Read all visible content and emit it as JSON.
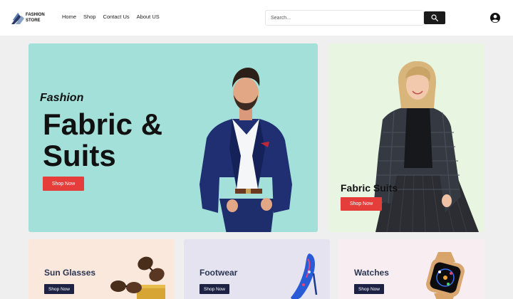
{
  "header": {
    "logo": {
      "line1": "FASHION",
      "line2": "STORE"
    },
    "nav": [
      {
        "label": "Home"
      },
      {
        "label": "Shop"
      },
      {
        "label": "Contact Us"
      },
      {
        "label": "About US"
      }
    ],
    "search": {
      "placeholder": "Search...",
      "icon": "search-icon"
    },
    "user_icon": "user-circle-icon"
  },
  "hero": {
    "subtitle": "Fashion",
    "title": "Fabric & Suits",
    "button": "Shop Now",
    "bg_color": "#a2e0d9",
    "accent": "#e53d3a"
  },
  "side_hero": {
    "title": "Fabric Suits",
    "button": "Shop Now",
    "bg_color": "#e8f5e0"
  },
  "categories": [
    {
      "title": "Sun Glasses",
      "button": "Shop Now",
      "bg_color": "#fbe8dd"
    },
    {
      "title": "Footwear",
      "button": "Shop Now",
      "bg_color": "#e5e3f0"
    },
    {
      "title": "Watches",
      "button": "Shop Now",
      "bg_color": "#f8eef2"
    }
  ]
}
